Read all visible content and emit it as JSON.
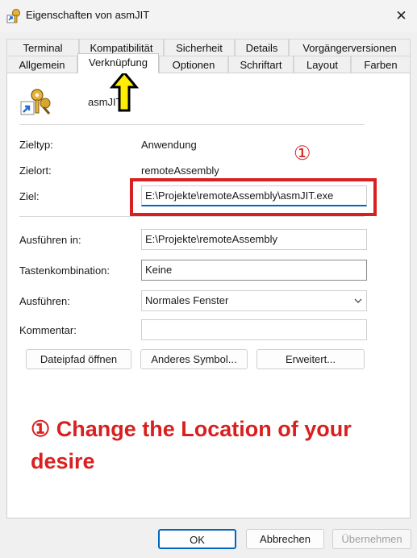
{
  "window": {
    "title": "Eigenschaften von asmJIT",
    "close_glyph": "✕"
  },
  "tabs_row1": [
    "Terminal",
    "Kompatibilität",
    "Sicherheit",
    "Details",
    "Vorgängerversionen"
  ],
  "tabs_row2": [
    "Allgemein",
    "Verknüpfung",
    "Optionen",
    "Schriftart",
    "Layout",
    "Farben"
  ],
  "header": {
    "name": "asmJIT"
  },
  "fields": {
    "zieltyp_label": "Zieltyp:",
    "zieltyp_value": "Anwendung",
    "zielort_label": "Zielort:",
    "zielort_value": "remoteAssembly",
    "ziel_label": "Ziel:",
    "ziel_value": "E:\\Projekte\\remoteAssembly\\asmJIT.exe",
    "ausfuehren_in_label": "Ausführen in:",
    "ausfuehren_in_value": "E:\\Projekte\\remoteAssembly",
    "tasten_label": "Tastenkombination:",
    "tasten_value": "Keine",
    "ausfuehren_label": "Ausführen:",
    "ausfuehren_value": "Normales Fenster",
    "kommentar_label": "Kommentar:",
    "kommentar_value": ""
  },
  "buttons": {
    "dateipfad": "Dateipfad öffnen",
    "symbol": "Anderes Symbol...",
    "erweitert": "Erweitert..."
  },
  "annotation": {
    "marker": "①",
    "text": "①  Change the Location of your desire"
  },
  "footer": {
    "ok": "OK",
    "cancel": "Abbrechen",
    "apply": "Übernehmen"
  },
  "colors": {
    "accent": "#0067c0",
    "annotation_red": "#d92020",
    "arrow_yellow": "#ffee00"
  }
}
